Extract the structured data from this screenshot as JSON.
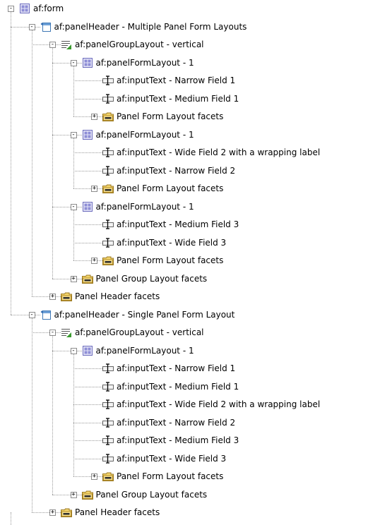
{
  "tree": {
    "nodes": [
      {
        "id": "n0",
        "label": "af:form",
        "icon": "form-icon",
        "toggle": "-",
        "depth": 0
      },
      {
        "id": "n1",
        "label": "af:panelHeader - Multiple Panel Form Layouts",
        "icon": "panel-header-icon",
        "toggle": "-",
        "depth": 1
      },
      {
        "id": "n2",
        "label": "af:panelGroupLayout - vertical",
        "icon": "panel-group-layout-icon",
        "toggle": "-",
        "depth": 2
      },
      {
        "id": "n3",
        "label": "af:panelFormLayout - 1",
        "icon": "panel-form-layout-icon",
        "toggle": "-",
        "depth": 3
      },
      {
        "id": "n4",
        "label": "af:inputText - Narrow Field 1",
        "icon": "input-text-icon",
        "toggle": "",
        "depth": 4
      },
      {
        "id": "n5",
        "label": "af:inputText - Medium Field 1",
        "icon": "input-text-icon",
        "toggle": "",
        "depth": 4
      },
      {
        "id": "n6",
        "label": "Panel Form Layout facets",
        "icon": "facets-folder-icon",
        "toggle": "+",
        "depth": 4
      },
      {
        "id": "n7",
        "label": "af:panelFormLayout - 1",
        "icon": "panel-form-layout-icon",
        "toggle": "-",
        "depth": 3
      },
      {
        "id": "n8",
        "label": "af:inputText - Wide Field 2 with a wrapping label",
        "icon": "input-text-icon",
        "toggle": "",
        "depth": 4
      },
      {
        "id": "n9",
        "label": "af:inputText - Narrow Field 2",
        "icon": "input-text-icon",
        "toggle": "",
        "depth": 4
      },
      {
        "id": "n10",
        "label": "Panel Form Layout facets",
        "icon": "facets-folder-icon",
        "toggle": "+",
        "depth": 4
      },
      {
        "id": "n11",
        "label": "af:panelFormLayout - 1",
        "icon": "panel-form-layout-icon",
        "toggle": "-",
        "depth": 3
      },
      {
        "id": "n12",
        "label": "af:inputText - Medium Field 3",
        "icon": "input-text-icon",
        "toggle": "",
        "depth": 4
      },
      {
        "id": "n13",
        "label": "af:inputText - Wide Field 3",
        "icon": "input-text-icon",
        "toggle": "",
        "depth": 4
      },
      {
        "id": "n14",
        "label": "Panel Form Layout facets",
        "icon": "facets-folder-icon",
        "toggle": "+",
        "depth": 4
      },
      {
        "id": "n15",
        "label": "Panel Group Layout facets",
        "icon": "facets-folder-icon",
        "toggle": "+",
        "depth": 3
      },
      {
        "id": "n16",
        "label": "Panel Header facets",
        "icon": "facets-folder-icon",
        "toggle": "+",
        "depth": 2
      },
      {
        "id": "n17",
        "label": "af:panelHeader - Single Panel Form Layout",
        "icon": "panel-header-icon",
        "toggle": "-",
        "depth": 1
      },
      {
        "id": "n18",
        "label": "af:panelGroupLayout - vertical",
        "icon": "panel-group-layout-icon",
        "toggle": "-",
        "depth": 2
      },
      {
        "id": "n19",
        "label": "af:panelFormLayout - 1",
        "icon": "panel-form-layout-icon",
        "toggle": "-",
        "depth": 3
      },
      {
        "id": "n20",
        "label": "af:inputText - Narrow Field 1",
        "icon": "input-text-icon",
        "toggle": "",
        "depth": 4
      },
      {
        "id": "n21",
        "label": "af:inputText - Medium Field 1",
        "icon": "input-text-icon",
        "toggle": "",
        "depth": 4
      },
      {
        "id": "n22",
        "label": "af:inputText - Wide Field 2 with a wrapping label",
        "icon": "input-text-icon",
        "toggle": "",
        "depth": 4
      },
      {
        "id": "n23",
        "label": "af:inputText - Narrow Field 2",
        "icon": "input-text-icon",
        "toggle": "",
        "depth": 4
      },
      {
        "id": "n24",
        "label": "af:inputText - Medium Field 3",
        "icon": "input-text-icon",
        "toggle": "",
        "depth": 4
      },
      {
        "id": "n25",
        "label": "af:inputText - Wide Field 3",
        "icon": "input-text-icon",
        "toggle": "",
        "depth": 4
      },
      {
        "id": "n26",
        "label": "Panel Form Layout facets",
        "icon": "facets-folder-icon",
        "toggle": "+",
        "depth": 4
      },
      {
        "id": "n27",
        "label": "Panel Group Layout facets",
        "icon": "facets-folder-icon",
        "toggle": "+",
        "depth": 3
      },
      {
        "id": "n28",
        "label": "Panel Header facets",
        "icon": "facets-folder-icon",
        "toggle": "+",
        "depth": 2
      }
    ]
  }
}
